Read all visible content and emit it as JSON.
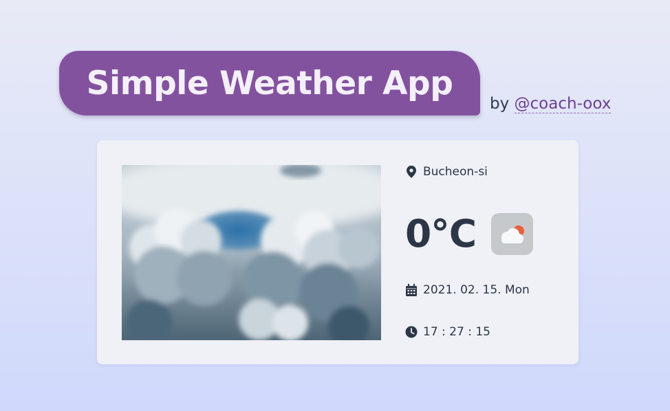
{
  "header": {
    "title": "Simple Weather App",
    "byline_prefix": "by",
    "author_link": "@coach-oox",
    "banner_color": "#83529f"
  },
  "weather": {
    "location": "Bucheon-si",
    "temperature": "0°C",
    "condition_icon": "cloudy-sun-icon",
    "date": "2021. 02. 15. Mon",
    "time": "17 : 27 : 15"
  },
  "icons": {
    "location": "map-pin-icon",
    "date": "calendar-icon",
    "time": "clock-icon"
  }
}
